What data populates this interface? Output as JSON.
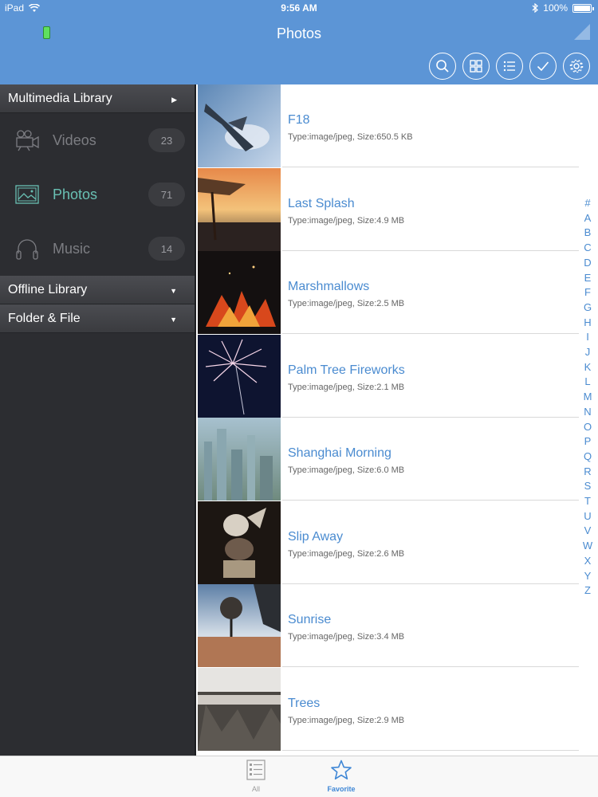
{
  "status": {
    "device": "iPad",
    "time": "9:56 AM",
    "battery": "100%"
  },
  "nav": {
    "title": "Photos"
  },
  "toolbar": {
    "icons": [
      "search-icon",
      "grid-view-icon",
      "list-view-icon",
      "check-icon",
      "gear-icon"
    ]
  },
  "sidebar": {
    "multimedia_header": "Multimedia Library",
    "items": [
      {
        "label": "Videos",
        "count": "23",
        "icon": "video-camera-icon"
      },
      {
        "label": "Photos",
        "count": "71",
        "icon": "photo-icon"
      },
      {
        "label": "Music",
        "count": "14",
        "icon": "headphones-icon"
      }
    ],
    "offline_header": "Offline Library",
    "folder_header": "Folder & File"
  },
  "photos": [
    {
      "title": "F18",
      "subtitle": "Type:image/jpeg, Size:650.5 KB"
    },
    {
      "title": "Last Splash",
      "subtitle": "Type:image/jpeg, Size:4.9 MB"
    },
    {
      "title": "Marshmallows",
      "subtitle": "Type:image/jpeg, Size:2.5 MB"
    },
    {
      "title": "Palm Tree Fireworks",
      "subtitle": "Type:image/jpeg, Size:2.1 MB"
    },
    {
      "title": "Shanghai Morning",
      "subtitle": "Type:image/jpeg, Size:6.0 MB"
    },
    {
      "title": "Slip Away",
      "subtitle": "Type:image/jpeg, Size:2.6 MB"
    },
    {
      "title": "Sunrise",
      "subtitle": "Type:image/jpeg, Size:3.4 MB"
    },
    {
      "title": "Trees",
      "subtitle": "Type:image/jpeg, Size:2.9 MB"
    }
  ],
  "index_letters": [
    "#",
    "A",
    "B",
    "C",
    "D",
    "E",
    "F",
    "G",
    "H",
    "I",
    "J",
    "K",
    "L",
    "M",
    "N",
    "O",
    "P",
    "Q",
    "R",
    "S",
    "T",
    "U",
    "V",
    "W",
    "X",
    "Y",
    "Z"
  ],
  "tabs": {
    "all": "All",
    "favorite": "Favorite"
  },
  "colors": {
    "header": "#5c95d6",
    "accent": "#4a8bd0",
    "sidebar_active": "#69c0b3"
  }
}
